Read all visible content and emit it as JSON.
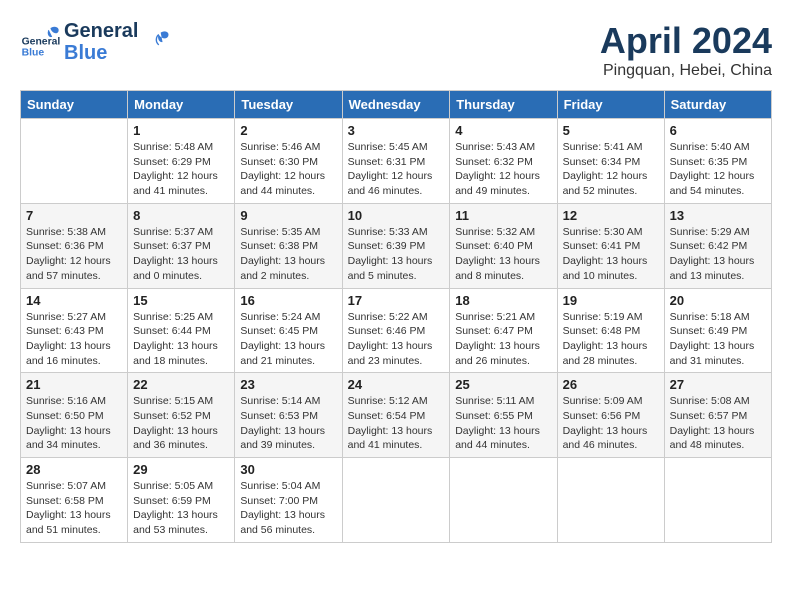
{
  "header": {
    "logo_general": "General",
    "logo_blue": "Blue",
    "month_title": "April 2024",
    "location": "Pingquan, Hebei, China"
  },
  "weekdays": [
    "Sunday",
    "Monday",
    "Tuesday",
    "Wednesday",
    "Thursday",
    "Friday",
    "Saturday"
  ],
  "weeks": [
    [
      {
        "day": "",
        "sunrise": "",
        "sunset": "",
        "daylight": ""
      },
      {
        "day": "1",
        "sunrise": "Sunrise: 5:48 AM",
        "sunset": "Sunset: 6:29 PM",
        "daylight": "Daylight: 12 hours and 41 minutes."
      },
      {
        "day": "2",
        "sunrise": "Sunrise: 5:46 AM",
        "sunset": "Sunset: 6:30 PM",
        "daylight": "Daylight: 12 hours and 44 minutes."
      },
      {
        "day": "3",
        "sunrise": "Sunrise: 5:45 AM",
        "sunset": "Sunset: 6:31 PM",
        "daylight": "Daylight: 12 hours and 46 minutes."
      },
      {
        "day": "4",
        "sunrise": "Sunrise: 5:43 AM",
        "sunset": "Sunset: 6:32 PM",
        "daylight": "Daylight: 12 hours and 49 minutes."
      },
      {
        "day": "5",
        "sunrise": "Sunrise: 5:41 AM",
        "sunset": "Sunset: 6:34 PM",
        "daylight": "Daylight: 12 hours and 52 minutes."
      },
      {
        "day": "6",
        "sunrise": "Sunrise: 5:40 AM",
        "sunset": "Sunset: 6:35 PM",
        "daylight": "Daylight: 12 hours and 54 minutes."
      }
    ],
    [
      {
        "day": "7",
        "sunrise": "Sunrise: 5:38 AM",
        "sunset": "Sunset: 6:36 PM",
        "daylight": "Daylight: 12 hours and 57 minutes."
      },
      {
        "day": "8",
        "sunrise": "Sunrise: 5:37 AM",
        "sunset": "Sunset: 6:37 PM",
        "daylight": "Daylight: 13 hours and 0 minutes."
      },
      {
        "day": "9",
        "sunrise": "Sunrise: 5:35 AM",
        "sunset": "Sunset: 6:38 PM",
        "daylight": "Daylight: 13 hours and 2 minutes."
      },
      {
        "day": "10",
        "sunrise": "Sunrise: 5:33 AM",
        "sunset": "Sunset: 6:39 PM",
        "daylight": "Daylight: 13 hours and 5 minutes."
      },
      {
        "day": "11",
        "sunrise": "Sunrise: 5:32 AM",
        "sunset": "Sunset: 6:40 PM",
        "daylight": "Daylight: 13 hours and 8 minutes."
      },
      {
        "day": "12",
        "sunrise": "Sunrise: 5:30 AM",
        "sunset": "Sunset: 6:41 PM",
        "daylight": "Daylight: 13 hours and 10 minutes."
      },
      {
        "day": "13",
        "sunrise": "Sunrise: 5:29 AM",
        "sunset": "Sunset: 6:42 PM",
        "daylight": "Daylight: 13 hours and 13 minutes."
      }
    ],
    [
      {
        "day": "14",
        "sunrise": "Sunrise: 5:27 AM",
        "sunset": "Sunset: 6:43 PM",
        "daylight": "Daylight: 13 hours and 16 minutes."
      },
      {
        "day": "15",
        "sunrise": "Sunrise: 5:25 AM",
        "sunset": "Sunset: 6:44 PM",
        "daylight": "Daylight: 13 hours and 18 minutes."
      },
      {
        "day": "16",
        "sunrise": "Sunrise: 5:24 AM",
        "sunset": "Sunset: 6:45 PM",
        "daylight": "Daylight: 13 hours and 21 minutes."
      },
      {
        "day": "17",
        "sunrise": "Sunrise: 5:22 AM",
        "sunset": "Sunset: 6:46 PM",
        "daylight": "Daylight: 13 hours and 23 minutes."
      },
      {
        "day": "18",
        "sunrise": "Sunrise: 5:21 AM",
        "sunset": "Sunset: 6:47 PM",
        "daylight": "Daylight: 13 hours and 26 minutes."
      },
      {
        "day": "19",
        "sunrise": "Sunrise: 5:19 AM",
        "sunset": "Sunset: 6:48 PM",
        "daylight": "Daylight: 13 hours and 28 minutes."
      },
      {
        "day": "20",
        "sunrise": "Sunrise: 5:18 AM",
        "sunset": "Sunset: 6:49 PM",
        "daylight": "Daylight: 13 hours and 31 minutes."
      }
    ],
    [
      {
        "day": "21",
        "sunrise": "Sunrise: 5:16 AM",
        "sunset": "Sunset: 6:50 PM",
        "daylight": "Daylight: 13 hours and 34 minutes."
      },
      {
        "day": "22",
        "sunrise": "Sunrise: 5:15 AM",
        "sunset": "Sunset: 6:52 PM",
        "daylight": "Daylight: 13 hours and 36 minutes."
      },
      {
        "day": "23",
        "sunrise": "Sunrise: 5:14 AM",
        "sunset": "Sunset: 6:53 PM",
        "daylight": "Daylight: 13 hours and 39 minutes."
      },
      {
        "day": "24",
        "sunrise": "Sunrise: 5:12 AM",
        "sunset": "Sunset: 6:54 PM",
        "daylight": "Daylight: 13 hours and 41 minutes."
      },
      {
        "day": "25",
        "sunrise": "Sunrise: 5:11 AM",
        "sunset": "Sunset: 6:55 PM",
        "daylight": "Daylight: 13 hours and 44 minutes."
      },
      {
        "day": "26",
        "sunrise": "Sunrise: 5:09 AM",
        "sunset": "Sunset: 6:56 PM",
        "daylight": "Daylight: 13 hours and 46 minutes."
      },
      {
        "day": "27",
        "sunrise": "Sunrise: 5:08 AM",
        "sunset": "Sunset: 6:57 PM",
        "daylight": "Daylight: 13 hours and 48 minutes."
      }
    ],
    [
      {
        "day": "28",
        "sunrise": "Sunrise: 5:07 AM",
        "sunset": "Sunset: 6:58 PM",
        "daylight": "Daylight: 13 hours and 51 minutes."
      },
      {
        "day": "29",
        "sunrise": "Sunrise: 5:05 AM",
        "sunset": "Sunset: 6:59 PM",
        "daylight": "Daylight: 13 hours and 53 minutes."
      },
      {
        "day": "30",
        "sunrise": "Sunrise: 5:04 AM",
        "sunset": "Sunset: 7:00 PM",
        "daylight": "Daylight: 13 hours and 56 minutes."
      },
      {
        "day": "",
        "sunrise": "",
        "sunset": "",
        "daylight": ""
      },
      {
        "day": "",
        "sunrise": "",
        "sunset": "",
        "daylight": ""
      },
      {
        "day": "",
        "sunrise": "",
        "sunset": "",
        "daylight": ""
      },
      {
        "day": "",
        "sunrise": "",
        "sunset": "",
        "daylight": ""
      }
    ]
  ]
}
